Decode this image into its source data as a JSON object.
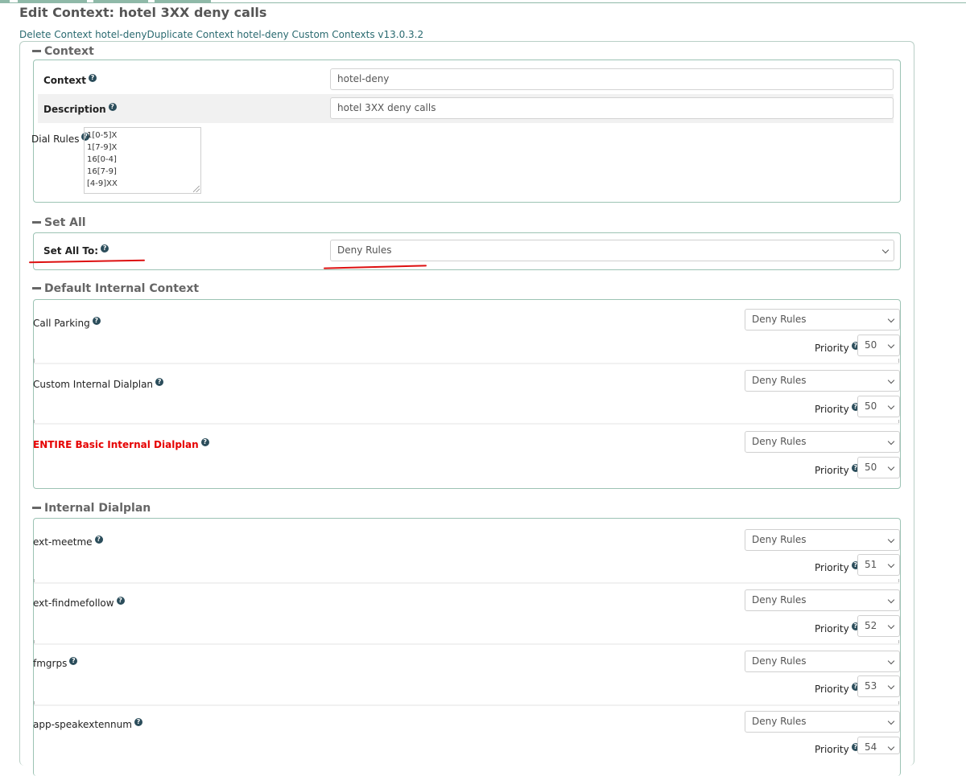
{
  "page": {
    "title": "Edit Context: hotel 3XX deny calls",
    "links": {
      "delete": "Delete Context hotel-deny",
      "duplicate": "Duplicate Context hotel-deny",
      "version": " Custom Contexts v13.0.3.2"
    }
  },
  "context_section": {
    "heading": "Context",
    "context_label": "Context",
    "context_value": "hotel-deny",
    "description_label": "Description",
    "description_value": "hotel 3XX deny calls",
    "dial_rules_label": "Dial Rules",
    "dial_rules": [
      "1[0-5]X",
      "1[7-9]X",
      "16[0-4]",
      "16[7-9]",
      "[4-9]XX"
    ]
  },
  "set_all": {
    "heading": "Set All",
    "label": "Set All To:",
    "value": "Deny Rules"
  },
  "default_internal": {
    "heading": "Default Internal Context",
    "rows": [
      {
        "label": "Call Parking",
        "value": "Deny Rules",
        "priority_label": "Priority",
        "priority": "50"
      },
      {
        "label": "Custom Internal Dialplan",
        "value": "Deny Rules",
        "priority_label": "Priority",
        "priority": "50"
      },
      {
        "label": "ENTIRE Basic Internal Dialplan",
        "value": "Deny Rules",
        "priority_label": "Priority",
        "priority": "50"
      }
    ]
  },
  "internal_dialplan": {
    "heading": "Internal Dialplan",
    "rows": [
      {
        "label": "ext-meetme",
        "value": "Deny Rules",
        "priority_label": "Priority",
        "priority": "51"
      },
      {
        "label": "ext-findmefollow",
        "value": "Deny Rules",
        "priority_label": "Priority",
        "priority": "52"
      },
      {
        "label": "fmgrps",
        "value": "Deny Rules",
        "priority_label": "Priority",
        "priority": "53"
      },
      {
        "label": "app-speakextennum",
        "value": "Deny Rules",
        "priority_label": "Priority",
        "priority": "54"
      }
    ]
  },
  "help_glyph": "?",
  "colors": {
    "link": "#2a6a70",
    "panel_border": "#9cc3b4",
    "annotation_red": "#dd1010",
    "warning_red": "#e60000"
  }
}
